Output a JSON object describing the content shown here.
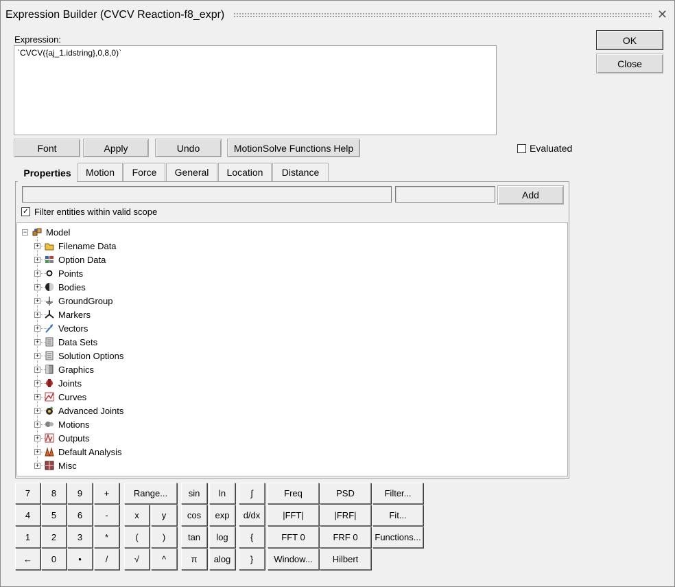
{
  "window": {
    "title": "Expression Builder (CVCV Reaction-f8_expr)"
  },
  "expression": {
    "label": "Expression:",
    "value": "`CVCV({aj_1.idstring},0,8,0)`"
  },
  "buttons": {
    "ok": "OK",
    "close": "Close",
    "font": "Font",
    "apply": "Apply",
    "undo": "Undo",
    "help": "MotionSolve Functions Help"
  },
  "evaluated": {
    "label": "Evaluated",
    "checked": false
  },
  "tabs": [
    "Properties",
    "Motion",
    "Force",
    "General",
    "Location",
    "Distance"
  ],
  "filter": {
    "add_label": "Add",
    "scope_label": "Filter entities within valid scope",
    "scope_checked": true,
    "search_value": "",
    "secondary_value": ""
  },
  "tree": {
    "root": "Model",
    "items": [
      {
        "label": "Filename Data",
        "icon": "folder-icon"
      },
      {
        "label": "Option Data",
        "icon": "option-data-icon"
      },
      {
        "label": "Points",
        "icon": "point-icon"
      },
      {
        "label": "Bodies",
        "icon": "body-icon"
      },
      {
        "label": "GroundGroup",
        "icon": "ground-icon"
      },
      {
        "label": "Markers",
        "icon": "marker-icon"
      },
      {
        "label": "Vectors",
        "icon": "vector-icon"
      },
      {
        "label": "Data Sets",
        "icon": "dataset-icon"
      },
      {
        "label": "Solution Options",
        "icon": "solution-options-icon"
      },
      {
        "label": "Graphics",
        "icon": "graphics-icon"
      },
      {
        "label": "Joints",
        "icon": "joint-icon"
      },
      {
        "label": "Curves",
        "icon": "curve-icon"
      },
      {
        "label": "Advanced Joints",
        "icon": "advanced-joint-icon"
      },
      {
        "label": "Motions",
        "icon": "motion-icon"
      },
      {
        "label": "Outputs",
        "icon": "output-icon"
      },
      {
        "label": "Default Analysis",
        "icon": "analysis-icon"
      },
      {
        "label": "Misc",
        "icon": "misc-icon"
      }
    ]
  },
  "keypad": {
    "digits": [
      "7",
      "8",
      "9",
      "+",
      "4",
      "5",
      "6",
      "-",
      "1",
      "2",
      "3",
      "*",
      "←",
      "0",
      "•",
      "/"
    ],
    "ops": [
      "Range...",
      "x",
      "y",
      "(",
      ")",
      "√",
      "^"
    ],
    "funcs": [
      "sin",
      "ln",
      "∫",
      "cos",
      "exp",
      "d/dx",
      "tan",
      "log",
      "{",
      "π",
      "alog",
      "}"
    ],
    "signal": [
      "Freq",
      "PSD",
      "Filter...",
      "|FFT|",
      "|FRF|",
      "Fit...",
      "FFT 0",
      "FRF 0",
      "Functions...",
      "Window...",
      "Hilbert"
    ]
  }
}
